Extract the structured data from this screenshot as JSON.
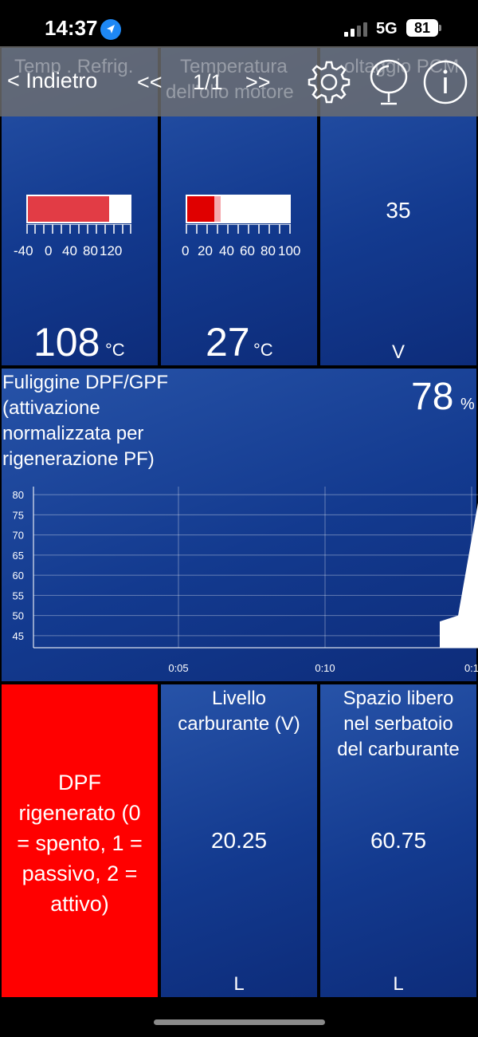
{
  "status": {
    "time": "14:37",
    "network": "5G",
    "battery": "81"
  },
  "nav": {
    "back": "< Indietro",
    "prev": "<<",
    "page": "1/1",
    "next": ">>",
    "ghost1": "Temp . Refrig.",
    "ghost2a": "Temperatura",
    "ghost2b": "dell'olio motore",
    "ghost3": "oltaggio PCM"
  },
  "tiles": {
    "coolant": {
      "value": "108",
      "unit": "°C",
      "scale": [
        "-40",
        "0",
        "40",
        "80",
        "120"
      ],
      "fill_fraction": 0.774
    },
    "oil": {
      "value": "27",
      "unit": "°C",
      "scale": [
        "0",
        "20",
        "40",
        "60",
        "80",
        "100"
      ],
      "fill_fraction": 0.27
    },
    "voltage": {
      "value": "35",
      "unit": "V"
    },
    "soot": {
      "label": [
        "Fuliggine DPF/GPF",
        "(attivazione",
        "normalizzata per",
        "rigenerazione PF)"
      ],
      "value": "78",
      "unit": "%"
    },
    "dpf": {
      "label": [
        "DPF",
        "rigenerato (0",
        "= spento, 1 =",
        "passivo, 2 =",
        "attivo)"
      ]
    },
    "fuel_level": {
      "label": [
        "Livello",
        "carburante (V)"
      ],
      "value": "20.25",
      "unit": "L"
    },
    "fuel_free": {
      "label": [
        "Spazio libero",
        "nel serbatoio",
        "del carburante"
      ],
      "value": "60.75",
      "unit": "L"
    }
  },
  "chart_data": {
    "type": "area",
    "title": "",
    "xlabel": "",
    "ylabel": "",
    "y_ticks": [
      "80",
      "75",
      "70",
      "65",
      "60",
      "55",
      "50",
      "45"
    ],
    "x_ticks": [
      "0:05",
      "0:10",
      "0:1"
    ],
    "ylim": [
      42,
      82
    ],
    "grid": true,
    "series": [
      {
        "x": [
          "0:13",
          "0:13",
          "0:14",
          "0:15",
          "0:15"
        ],
        "values": [
          42,
          48.5,
          50,
          78,
          42
        ]
      }
    ]
  },
  "colors": {
    "tile_blue": "#133a8f",
    "alert_red": "#ff0000",
    "bar_red": "#e23c45"
  }
}
